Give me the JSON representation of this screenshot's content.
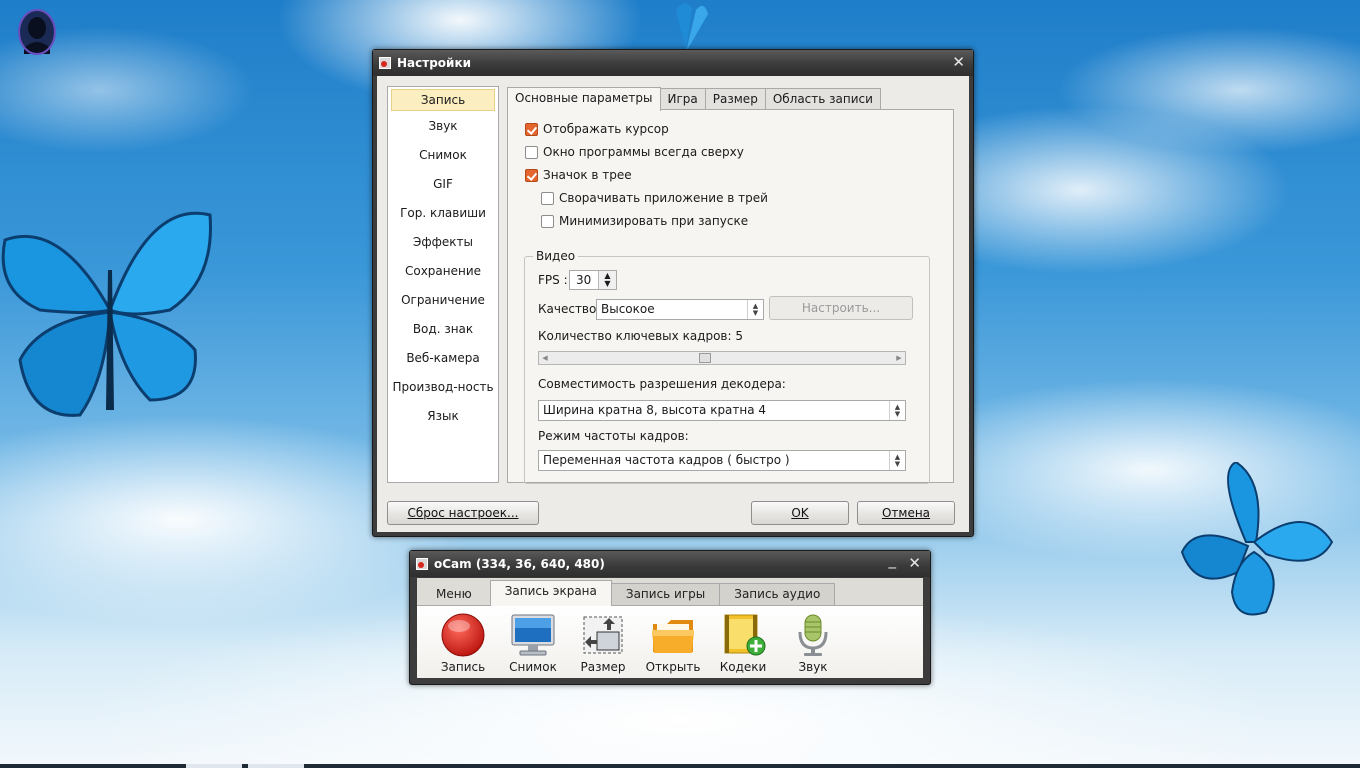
{
  "settings_window": {
    "title": "Настройки",
    "close_glyph": "✕",
    "sidebar_items": [
      {
        "label": "Запись",
        "selected": true
      },
      {
        "label": "Звук"
      },
      {
        "label": "Снимок"
      },
      {
        "label": "GIF"
      },
      {
        "label": "Гор. клавиши"
      },
      {
        "label": "Эффекты"
      },
      {
        "label": "Сохранение"
      },
      {
        "label": "Ограничение"
      },
      {
        "label": "Вод. знак"
      },
      {
        "label": "Веб-камера"
      },
      {
        "label": "Производ-ность"
      },
      {
        "label": "Язык"
      }
    ],
    "tabs": [
      {
        "label": "Основные параметры",
        "active": true
      },
      {
        "label": "Игра"
      },
      {
        "label": "Размер"
      },
      {
        "label": "Область записи"
      }
    ],
    "options": {
      "show_cursor": {
        "label": "Отображать курсор",
        "checked": true
      },
      "always_on_top": {
        "label": "Окно программы всегда сверху",
        "checked": false
      },
      "tray_icon": {
        "label": "Значок в трее",
        "checked": true
      },
      "minimize_to_tray": {
        "label": "Сворачивать приложение в трей",
        "checked": false
      },
      "minimize_on_start": {
        "label": "Минимизировать при запуске",
        "checked": false
      }
    },
    "video": {
      "group_label": "Видео",
      "fps_label": "FPS :",
      "fps_value": "30",
      "quality_label": "Качество:",
      "quality_value": "Высокое",
      "configure_button": "Настроить...",
      "keyframes_label": "Количество ключевых кадров: 5",
      "keyframes_value": 5,
      "decoder_label": "Совместимость разрешения декодера:",
      "decoder_value": "Ширина кратна 8, высота кратна 4",
      "framerate_mode_label": "Режим частоты кадров:",
      "framerate_mode_value": "Переменная частота кадров ( быстро )"
    },
    "buttons": {
      "reset": "Сброс настроек...",
      "ok": "OK",
      "cancel": "Отмена"
    }
  },
  "ocam_window": {
    "title": "oCam (334, 36, 640, 480)",
    "minimize_glyph": "_",
    "close_glyph": "✕",
    "tabs": [
      {
        "label": "Меню"
      },
      {
        "label": "Запись экрана",
        "active": true
      },
      {
        "label": "Запись игры"
      },
      {
        "label": "Запись аудио"
      }
    ],
    "tools": [
      {
        "label": "Запись",
        "icon": "record-icon"
      },
      {
        "label": "Снимок",
        "icon": "monitor-icon"
      },
      {
        "label": "Размер",
        "icon": "resize-icon"
      },
      {
        "label": "Открыть",
        "icon": "folder-icon"
      },
      {
        "label": "Кодеки",
        "icon": "codec-icon"
      },
      {
        "label": "Звук",
        "icon": "microphone-icon"
      }
    ]
  },
  "colors": {
    "checkbox_checked": "#e4652e",
    "selected_sidebar": "#fbeec1",
    "title_bar": "#3b3b3b",
    "record_red": "#d7261e"
  }
}
